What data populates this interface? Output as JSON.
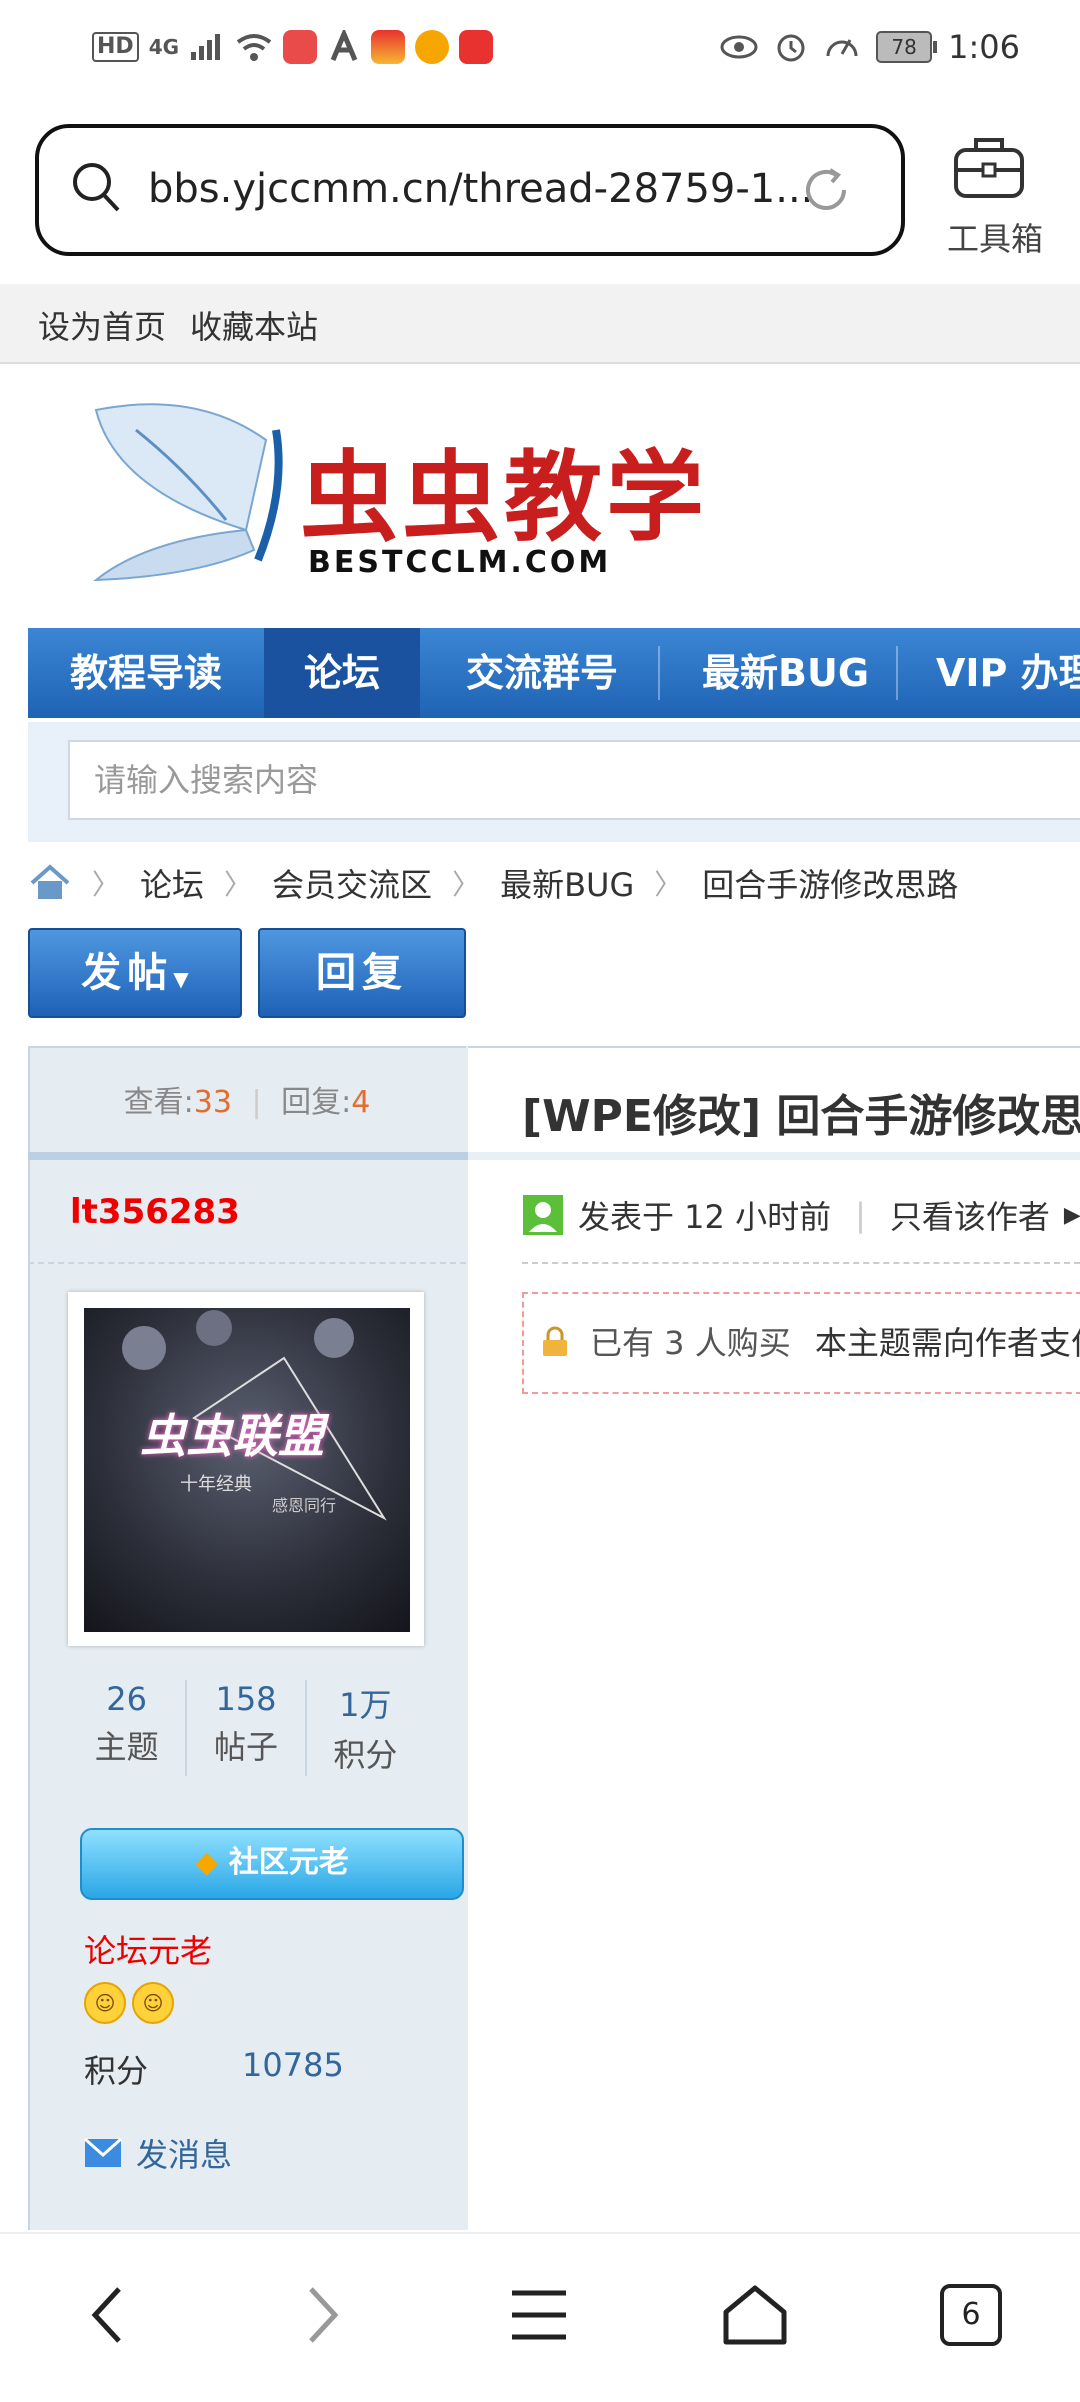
{
  "status_bar": {
    "left_tags": [
      "HD",
      "4G"
    ],
    "battery": "78",
    "time": "1:06"
  },
  "browser": {
    "url": "bbs.yjccmm.cn/thread-28759-1...",
    "toolbox_label": "工具箱"
  },
  "site": {
    "top_links": [
      "设为首页",
      "收藏本站"
    ],
    "logo_text": "虫虫教学",
    "logo_sub": "BESTCCLM.COM",
    "nav": [
      "教程导读",
      "论坛",
      "交流群号",
      "最新BUG",
      "VIP 办理"
    ],
    "nav_active_index": 1,
    "search_placeholder": "请输入搜索内容",
    "breadcrumb": [
      "论坛",
      "会员交流区",
      "最新BUG",
      "回合手游修改思路"
    ],
    "buttons": {
      "post": "发帖",
      "reply": "回复"
    }
  },
  "thread": {
    "views_label": "查看:",
    "views": "33",
    "replies_label": "回复:",
    "replies": "4",
    "title": "[WPE修改] 回合手游修改思路",
    "meta_posted": "发表于 12 小时前",
    "meta_only_author": "只看该作者",
    "buy_count_text": "已有 3 人购买",
    "buy_notice": "本主题需向作者支付"
  },
  "author": {
    "username": "lt356283",
    "avatar_title": "虫虫联盟",
    "avatar_sub1": "十年经典",
    "avatar_sub2": "感恩同行",
    "stats": [
      {
        "value": "26",
        "label": "主题"
      },
      {
        "value": "158",
        "label": "帖子"
      },
      {
        "value": "1万",
        "label": "积分"
      }
    ],
    "medal": "社区元老",
    "rank": "论坛元老",
    "score_label": "积分",
    "score": "10785",
    "message_label": "发消息"
  },
  "bottom_nav": {
    "tabs_count": "6"
  }
}
